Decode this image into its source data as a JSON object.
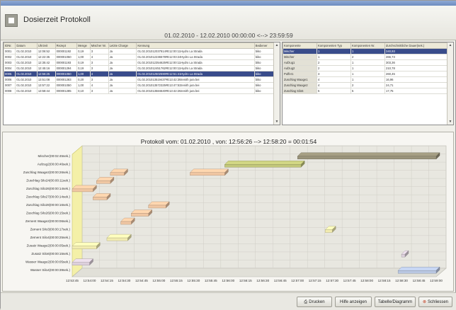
{
  "window": {
    "title": "Dosierzeit Protokoll",
    "date_range": "01.02.2010 - 12.02.2010   00:00:00 <--> 23:59:59"
  },
  "log_table": {
    "columns": [
      "IDNr.",
      "Datum",
      "Uhrzeit",
      "Rezept",
      "Menge",
      "Mischer Nr.",
      "Letzte Charge",
      "Kennung",
      "Bediener"
    ],
    "rows": [
      [
        "0001",
        "01.02.2010",
        "12:06:52",
        "000001192",
        "0,19",
        "3",
        "Ja",
        "01.02.201012037814#E12:00:11Hydro La Strada",
        "biko"
      ],
      [
        "0002",
        "01.02.2010",
        "12:22:35",
        "000001050",
        "1,00",
        "4",
        "Ja",
        "01.02.201012236578#E12:03:24Hydro La Strada",
        "biko"
      ],
      [
        "0003",
        "01.02.2010",
        "12:35:42",
        "000001193",
        "0,19",
        "3",
        "Ja",
        "01.02.201012354625#E12:00:11Hydro La Strada",
        "biko"
      ],
      [
        "0004",
        "01.02.2010",
        "12:45:16",
        "000001294",
        "0,19",
        "3",
        "Ja",
        "01.02.201012451762#E12:00:11Hydro La Strada",
        "biko"
      ],
      [
        "0005",
        "01.02.2010",
        "12:56:25",
        "000001050",
        "1,00",
        "4",
        "Ja",
        "01.02.201012502590#E12:51:41Hydro La Strada",
        "biko"
      ],
      [
        "0006",
        "01.02.2010",
        "13:51:08",
        "000001283",
        "0,20",
        "3",
        "Ja",
        "01.02.201013519437#E13:42:39zenith jura bei",
        "biko"
      ],
      [
        "0007",
        "01.02.2010",
        "13:57:22",
        "000001050",
        "1,00",
        "4",
        "Ja",
        "01.02.201013572325#E13:47:53zenith jura bei",
        "biko"
      ],
      [
        "0008",
        "01.02.2010",
        "13:58:44",
        "000001285",
        "0,10",
        "3",
        "Ja",
        "01.02.201013584640#E13:42:26zenith jura bei",
        "biko"
      ]
    ],
    "selected_row": 4
  },
  "component_table": {
    "columns": [
      "Komponente",
      "Komponenten Typ",
      "Komponenten Nr.",
      "durchschnittliche Dauer(sek.)"
    ],
    "rows": [
      [
        "Mischer",
        "1",
        "1",
        "340,93"
      ],
      [
        "Mischer",
        "1",
        "2",
        "266,73"
      ],
      [
        "Aufzug1",
        "2",
        "1",
        "303,36"
      ],
      [
        "Aufzug2",
        "2",
        "1",
        "210,78"
      ],
      [
        "Puffer1",
        "3",
        "1",
        "260,45"
      ],
      [
        "Zuschlag Waage1",
        "4",
        "1",
        "16,96"
      ],
      [
        "Zuschlag Waage2",
        "4",
        "2",
        "24,71"
      ],
      [
        "Zuschlag Silo5",
        "5",
        "5",
        "17,75"
      ]
    ],
    "selected_row": 0
  },
  "chart_data": {
    "type": "gantt",
    "title": "Protokoll vom: 01.02.2010 , von: 12:56:26 --> 12:58:20 = 00:01:54",
    "categories": [
      "Mischer(00:02:45sek.)",
      "Aufzug2(00:00:46sek.)",
      "Zuschlag Waage2(00:00:26sek.)",
      "Zuschlag Silo24(00:00:11sek.)",
      "Zuschlag Silo26(00:00:14sek.)",
      "Zuschlag Silo27(00:00:14sek.)",
      "Zuschlag Silo28(00:00:16sek.)",
      "Zuschlag Silo26(00:00:15sek.)",
      "Zement Waage2(00:00:06sek.)",
      "Zement Silo3(00:00:17sek.)",
      "Zement Silo4(00:00:25sek.)",
      "Zusatz Waage2(00:00:05sek.)",
      "Zusatz Silo6(00:00:15sek.)",
      "Wasser Waage2(00:00:05sek.)",
      "Wasser Silo4(00:00:39sek.)"
    ],
    "x_ticks": [
      "12:53:45",
      "12:54:00",
      "12:54:15",
      "12:54:30",
      "12:54:45",
      "12:55:00",
      "12:55:15",
      "12:55:30",
      "12:55:45",
      "12:56:00",
      "12:56:15",
      "12:56:30",
      "12:56:45",
      "12:57:00",
      "12:57:15",
      "12:57:30",
      "12:57:45",
      "12:58:00",
      "12:58:15",
      "12:58:30",
      "12:58:45",
      "12:59:00"
    ],
    "x_unit": "seconds after 12:53:45",
    "xlim": [
      0,
      315
    ],
    "bars": [
      {
        "row": 0,
        "start": 195,
        "end": 315,
        "color": "#9a937a"
      },
      {
        "row": 1,
        "start": 132,
        "end": 198,
        "color": "#c2c77a"
      },
      {
        "row": 2,
        "start": 102,
        "end": 132,
        "color": "#f0c7a3"
      },
      {
        "row": 2,
        "start": 33,
        "end": 45,
        "color": "#f0c7a3"
      },
      {
        "row": 3,
        "start": 21,
        "end": 33,
        "color": "#f0c7a3"
      },
      {
        "row": 4,
        "start": 0,
        "end": 18,
        "color": "#f0c7a3"
      },
      {
        "row": 5,
        "start": 18,
        "end": 30,
        "color": "#f0c7a3"
      },
      {
        "row": 6,
        "start": 66,
        "end": 81,
        "color": "#f0c7a3"
      },
      {
        "row": 7,
        "start": 51,
        "end": 66,
        "color": "#f0c7a3"
      },
      {
        "row": 8,
        "start": 42,
        "end": 51,
        "color": "#f0c7a3"
      },
      {
        "row": 9,
        "start": 219,
        "end": 225,
        "color": "#f2ecb0"
      },
      {
        "row": 10,
        "start": 30,
        "end": 48,
        "color": "#f2ecb0"
      },
      {
        "row": 11,
        "start": 0,
        "end": 21,
        "color": "#f2ecb0"
      },
      {
        "row": 12,
        "start": 285,
        "end": 288,
        "color": "#ddd0dc"
      },
      {
        "row": 13,
        "start": 0,
        "end": 15,
        "color": "#ddd0dc"
      },
      {
        "row": 15,
        "start": 0,
        "end": 0,
        "color": "#b9c7e2"
      },
      {
        "row": 14,
        "start": 282,
        "end": 315,
        "color": "#b9c7e2"
      }
    ],
    "colors": {
      "back_wall": "#e8e7e0",
      "side_wall": "#f4f0a8",
      "grid": "#cfcec6"
    }
  },
  "footer": {
    "print_label": "Drucken",
    "help_label": "Hilfe anzeigen",
    "table_chart_label": "Tabelle/Diagramm",
    "close_label": "Schliessen"
  }
}
